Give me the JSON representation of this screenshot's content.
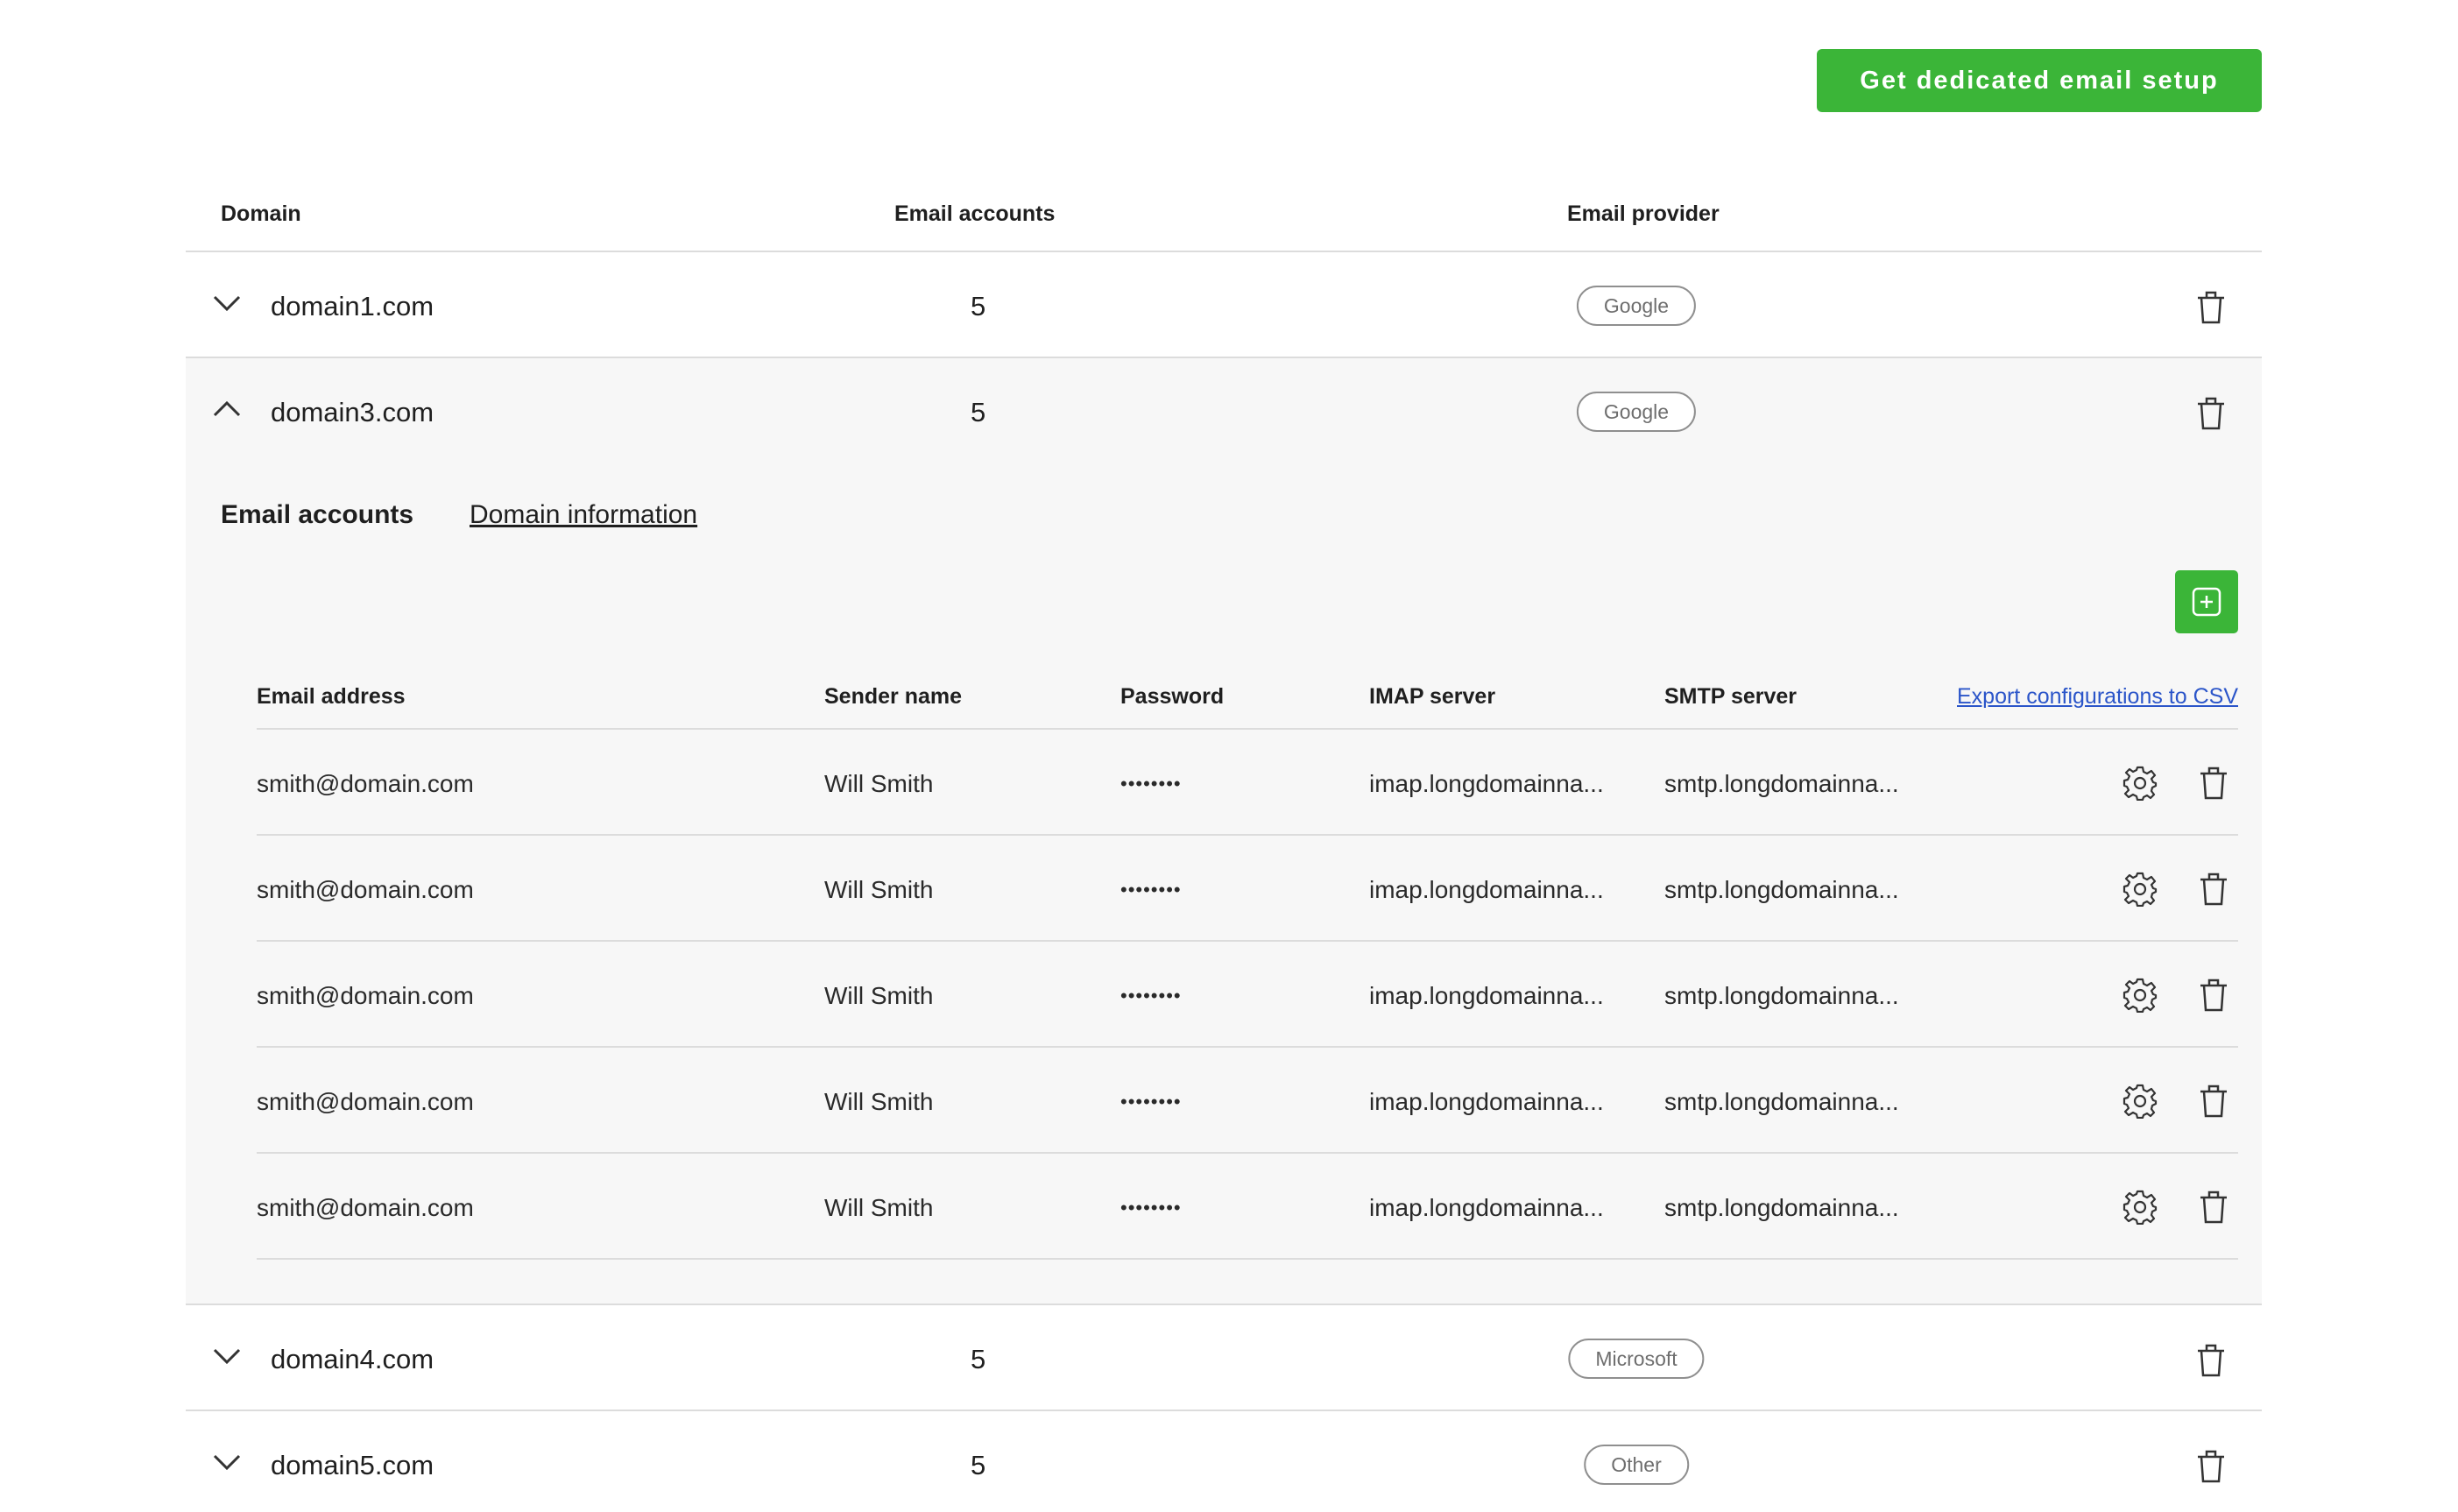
{
  "cta_label": "Get dedicated email setup",
  "columns": {
    "domain": "Domain",
    "accounts": "Email accounts",
    "provider": "Email provider"
  },
  "domains": [
    {
      "name": "domain1.com",
      "count": "5",
      "provider": "Google",
      "expanded": false
    },
    {
      "name": "domain3.com",
      "count": "5",
      "provider": "Google",
      "expanded": true
    },
    {
      "name": "domain4.com",
      "count": "5",
      "provider": "Microsoft",
      "expanded": false
    },
    {
      "name": "domain5.com",
      "count": "5",
      "provider": "Other",
      "expanded": false
    }
  ],
  "expanded": {
    "tabs": {
      "active": "Email accounts",
      "other": "Domain information"
    },
    "sub_columns": {
      "email": "Email address",
      "sender": "Sender name",
      "password": "Password",
      "imap": "IMAP server",
      "smtp": "SMTP server"
    },
    "export_label": "Export configurations to CSV",
    "accounts": [
      {
        "email": "smith@domain.com",
        "sender": "Will Smith",
        "password": "••••••••",
        "imap": "imap.longdomainna...",
        "smtp": "smtp.longdomainna..."
      },
      {
        "email": "smith@domain.com",
        "sender": "Will Smith",
        "password": "••••••••",
        "imap": "imap.longdomainna...",
        "smtp": "smtp.longdomainna..."
      },
      {
        "email": "smith@domain.com",
        "sender": "Will Smith",
        "password": "••••••••",
        "imap": "imap.longdomainna...",
        "smtp": "smtp.longdomainna..."
      },
      {
        "email": "smith@domain.com",
        "sender": "Will Smith",
        "password": "••••••••",
        "imap": "imap.longdomainna...",
        "smtp": "smtp.longdomainna..."
      },
      {
        "email": "smith@domain.com",
        "sender": "Will Smith",
        "password": "••••••••",
        "imap": "imap.longdomainna...",
        "smtp": "smtp.longdomainna..."
      }
    ]
  },
  "colors": {
    "accent": "#3bb538",
    "link": "#2b55c9",
    "expanded_bg": "#f7f7f7",
    "divider": "#dcdcdc"
  },
  "icons": {
    "expand": "chevron-down-icon",
    "collapse": "chevron-up-icon",
    "delete": "trash-icon",
    "settings": "gear-icon",
    "add": "add-square-icon"
  }
}
